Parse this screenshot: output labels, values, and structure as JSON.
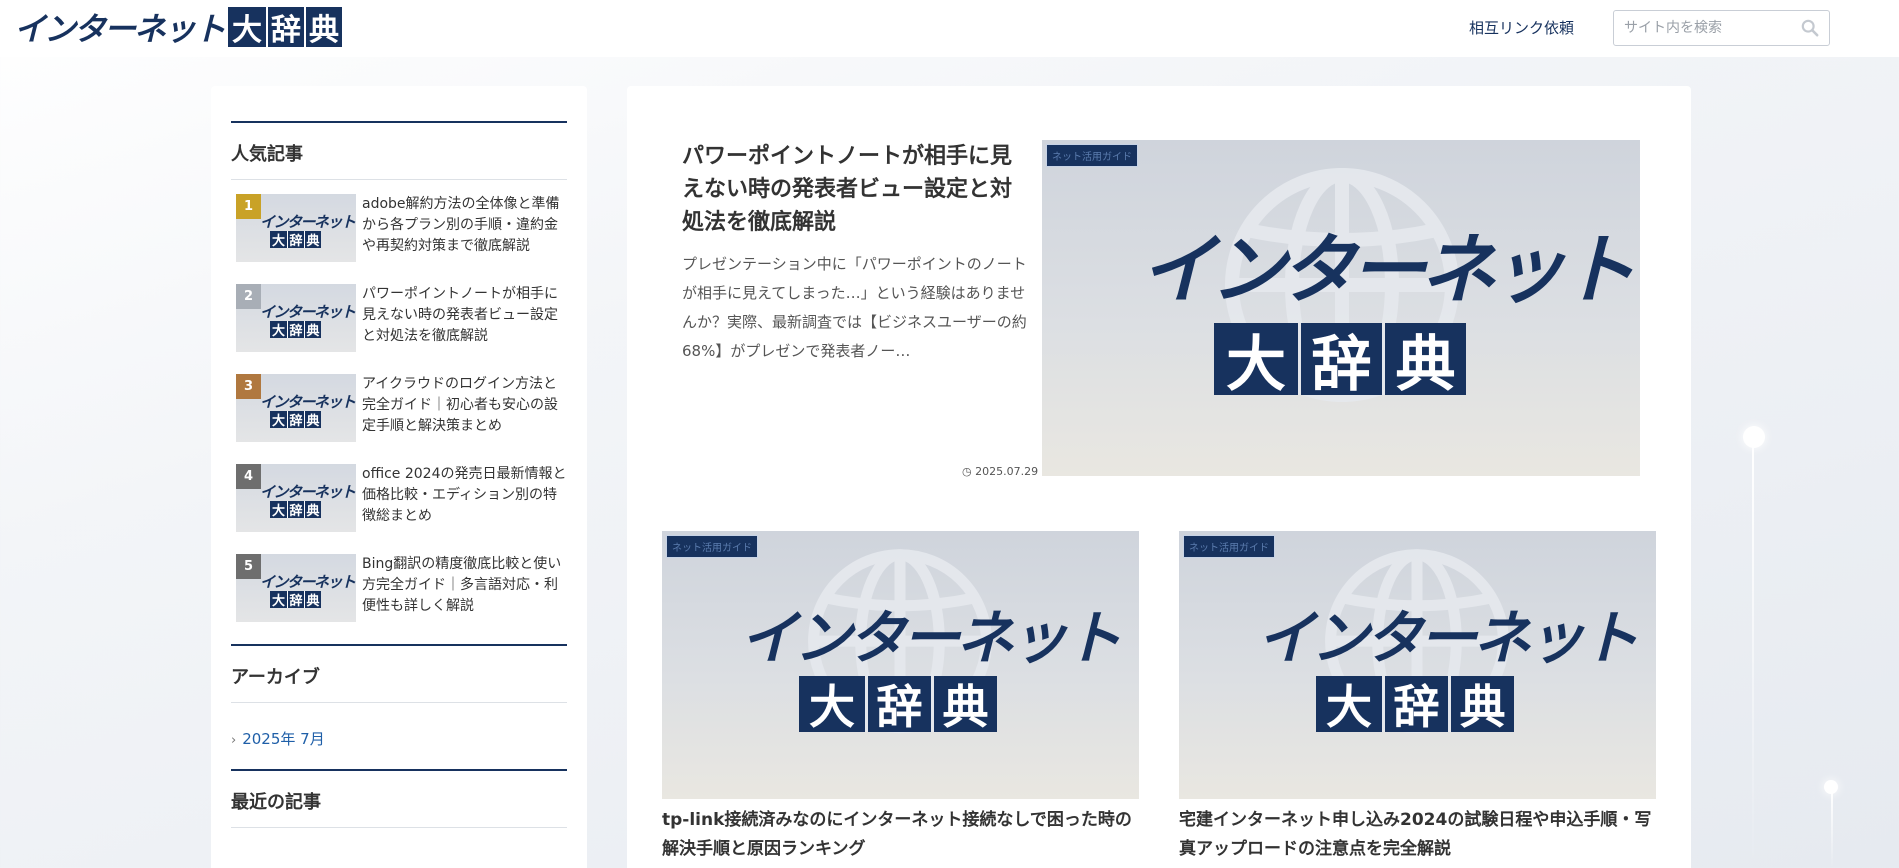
{
  "header": {
    "logo_kana": "インターネット",
    "logo_kanji": [
      "大",
      "辞",
      "典"
    ],
    "link_label": "相互リンク依頼",
    "search_placeholder": "サイト内を検索"
  },
  "sidebar": {
    "popular_title": "人気記事",
    "popular_items": [
      {
        "rank": "1",
        "badge_color": "#c9a227",
        "title": "adobe解約方法の全体像と準備から各プラン別の手順・違約金や再契約対策まで徹底解説"
      },
      {
        "rank": "2",
        "badge_color": "#a8aeb6",
        "title": "パワーポイントノートが相手に見えない時の発表者ビュー設定と対処法を徹底解説"
      },
      {
        "rank": "3",
        "badge_color": "#b0783f",
        "title": "アイクラウドのログイン方法と完全ガイド｜初心者も安心の設定手順と解決策まとめ"
      },
      {
        "rank": "4",
        "badge_color": "#6e6e6e",
        "title": "office 2024の発売日最新情報と価格比較・エディション別の特徴総まとめ"
      },
      {
        "rank": "5",
        "badge_color": "#6e6e6e",
        "title": "Bing翻訳の精度徹底比較と使い方完全ガイド｜多言語対応・利便性も詳しく解説"
      }
    ],
    "archive_title": "アーカイブ",
    "archive_items": [
      "2025年 7月"
    ],
    "recent_title": "最近の記事"
  },
  "thumbnail": {
    "kana": "インターネット",
    "kanji": [
      "大",
      "辞",
      "典"
    ]
  },
  "featured": {
    "category": "ネット活用ガイド",
    "title": "パワーポイントノートが相手に見えない時の発表者ビュー設定と対処法を徹底解説",
    "excerpt": "プレゼンテーション中に「パワーポイントのノートが相手に見えてしまった…」という経験はありませんか？実際、最新調査では【ビジネスユーザーの約68%】がプレゼンで発表者ノー…",
    "date": "2025.07.29"
  },
  "cards": [
    {
      "category": "ネット活用ガイド",
      "title": "tp-link接続済みなのにインターネット接続なしで困った時の解決手順と原因ランキング"
    },
    {
      "category": "ネット活用ガイド",
      "title": "宅建インターネット申し込み2024の試験日程や申込手順・写真アップロードの注意点を完全解説"
    }
  ],
  "colors": {
    "brand_navy": "#17325e",
    "link_blue": "#1f5fa8"
  }
}
